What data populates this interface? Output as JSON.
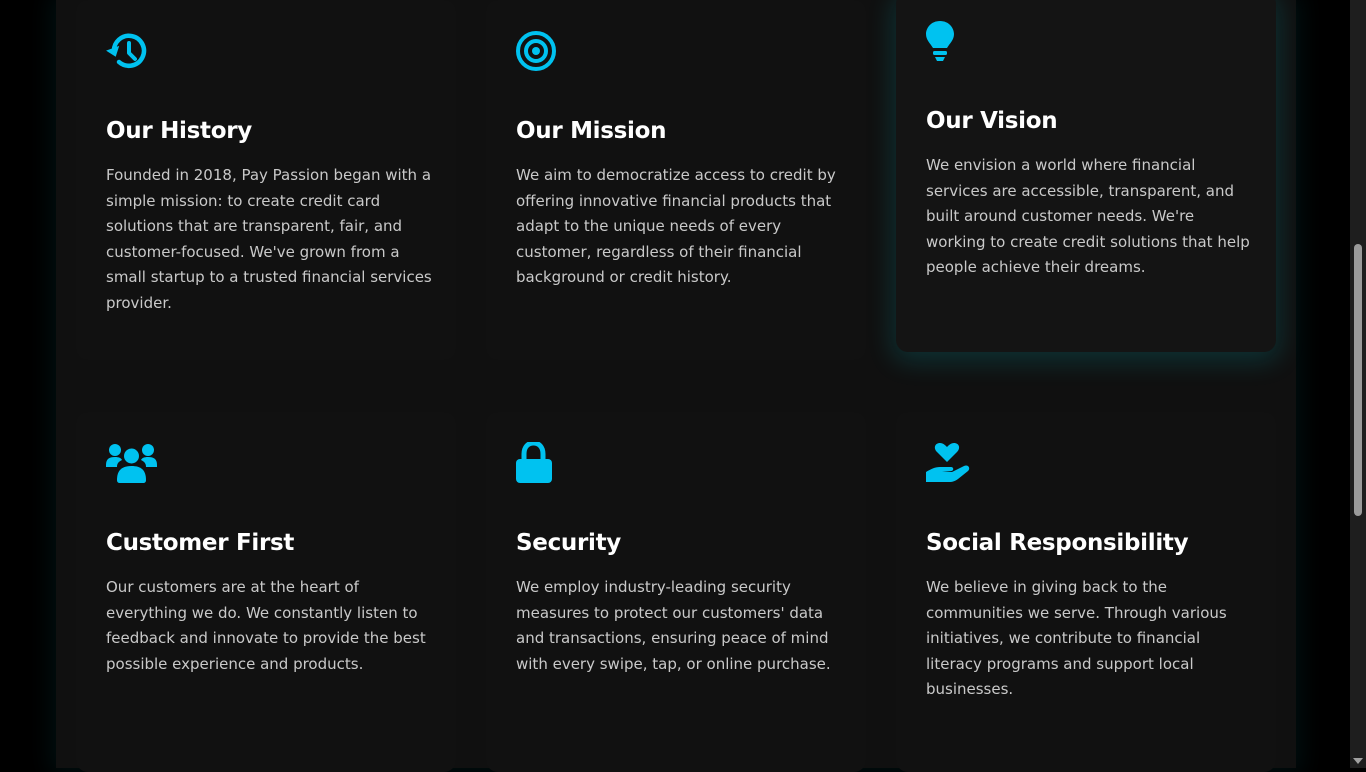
{
  "colors": {
    "accent": "#00c2f0",
    "background": "#000000",
    "card_background": "#111111",
    "title": "#ffffff",
    "text": "#c9c9c9"
  },
  "cards": [
    {
      "icon": "history-icon",
      "title": "Our History",
      "text": "Founded in 2018, Pay Passion began with a simple mission: to create credit card solutions that are transparent, fair, and customer-focused. We've grown from a small startup to a trusted financial services provider."
    },
    {
      "icon": "target-icon",
      "title": "Our Mission",
      "text": "We aim to democratize access to credit by offering innovative financial products that adapt to the unique needs of every customer, regardless of their financial background or credit history."
    },
    {
      "icon": "lightbulb-icon",
      "title": "Our Vision",
      "text": "We envision a world where financial services are accessible, transparent, and built around customer needs. We're working to create credit solutions that help people achieve their dreams."
    },
    {
      "icon": "users-icon",
      "title": "Customer First",
      "text": "Our customers are at the heart of everything we do. We constantly listen to feedback and innovate to provide the best possible experience and products."
    },
    {
      "icon": "lock-icon",
      "title": "Security",
      "text": "We employ industry-leading security measures to protect our customers' data and transactions, ensuring peace of mind with every swipe, tap, or online purchase."
    },
    {
      "icon": "hand-holding-heart-icon",
      "title": "Social Responsibility",
      "text": "We believe in giving back to the communities we serve. Through various initiatives, we contribute to financial literacy programs and support local businesses."
    }
  ]
}
